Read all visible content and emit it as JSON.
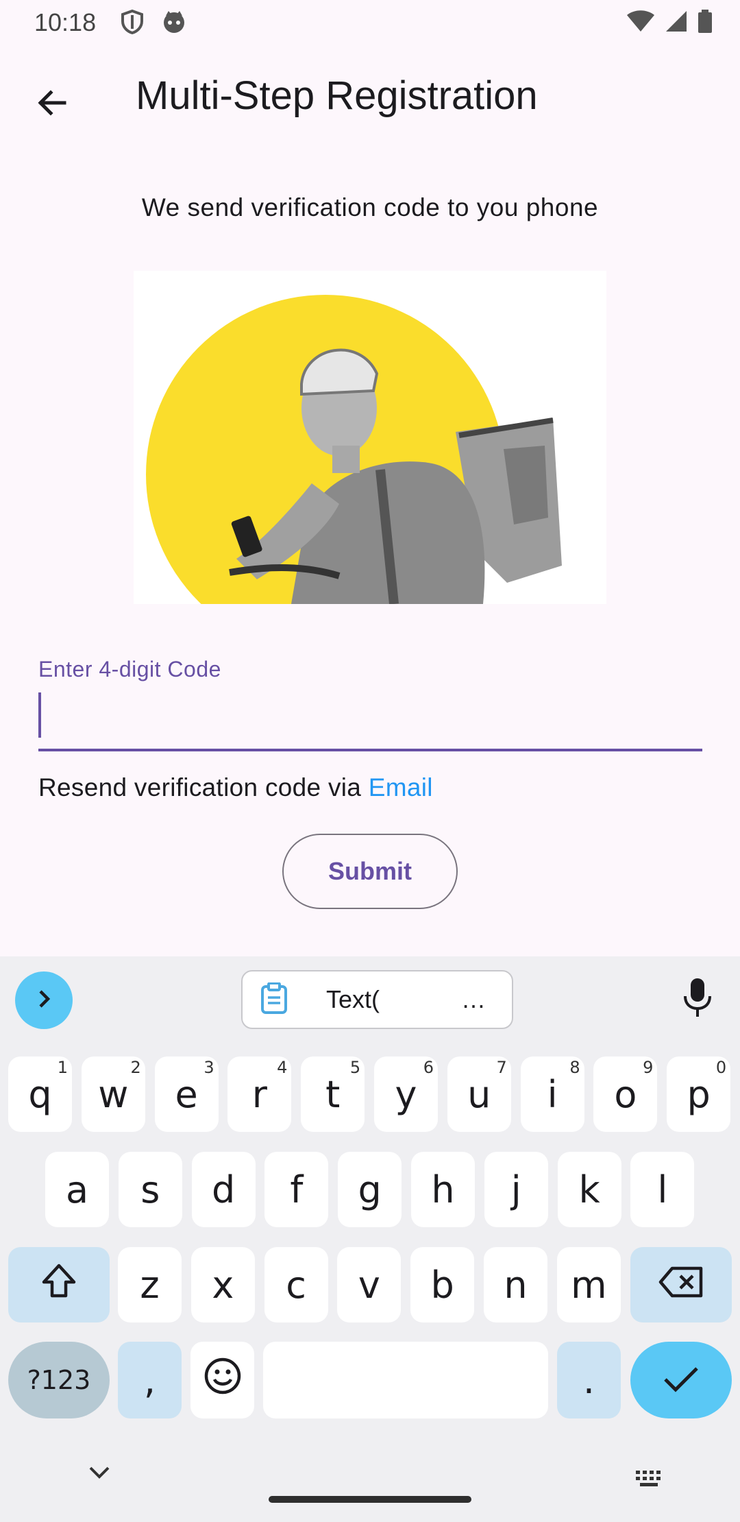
{
  "status_bar": {
    "time": "10:18"
  },
  "app_bar": {
    "title": "Multi-Step Registration"
  },
  "main": {
    "subtitle": "We send verification code to you phone",
    "code_field": {
      "label": "Enter 4-digit Code",
      "value": ""
    },
    "resend_text": "Resend verification code via ",
    "resend_link": "Email",
    "submit_label": "Submit"
  },
  "keyboard": {
    "clipboard_text": "Text(",
    "clipboard_ellipsis": "…",
    "row1": [
      {
        "key": "q",
        "hint": "1"
      },
      {
        "key": "w",
        "hint": "2"
      },
      {
        "key": "e",
        "hint": "3"
      },
      {
        "key": "r",
        "hint": "4"
      },
      {
        "key": "t",
        "hint": "5"
      },
      {
        "key": "y",
        "hint": "6"
      },
      {
        "key": "u",
        "hint": "7"
      },
      {
        "key": "i",
        "hint": "8"
      },
      {
        "key": "o",
        "hint": "9"
      },
      {
        "key": "p",
        "hint": "0"
      }
    ],
    "row2": [
      "a",
      "s",
      "d",
      "f",
      "g",
      "h",
      "j",
      "k",
      "l"
    ],
    "row3": [
      "z",
      "x",
      "c",
      "v",
      "b",
      "n",
      "m"
    ],
    "symbols_label": "?123",
    "comma": ",",
    "period": "."
  },
  "colors": {
    "accent": "#6750A4",
    "link": "#2196F3",
    "keyboard_accent": "#5AC8F5",
    "illustration_circle": "#FADD2C"
  }
}
